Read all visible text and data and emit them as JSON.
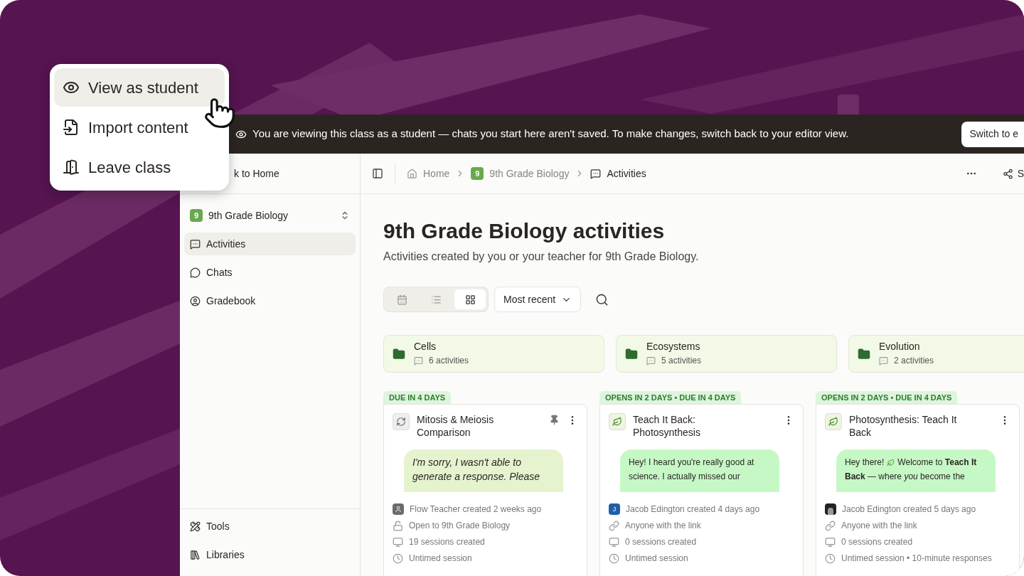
{
  "menu": {
    "items": [
      {
        "label": "View as student",
        "kind": "view",
        "selected": true
      },
      {
        "label": "Import content",
        "kind": "import",
        "selected": false
      },
      {
        "label": "Leave class",
        "kind": "leave",
        "selected": false
      }
    ]
  },
  "banner": {
    "text": "You are viewing this class as a student — chats you start here aren't saved. To make changes, switch back to your editor view.",
    "button": "Switch to e"
  },
  "sidebar": {
    "back_link": "k to Home",
    "class_badge": "9",
    "class_name": "9th Grade Biology",
    "items": [
      {
        "label": "Activities",
        "kind": "activities",
        "selected": true
      },
      {
        "label": "Chats",
        "kind": "chats",
        "selected": false
      },
      {
        "label": "Gradebook",
        "kind": "gradebook",
        "selected": false
      }
    ],
    "footer_items": [
      {
        "label": "Tools",
        "kind": "tools"
      },
      {
        "label": "Libraries",
        "kind": "libraries"
      }
    ]
  },
  "breadcrumbs": [
    {
      "kind": "home",
      "label": "Home"
    },
    {
      "kind": "class",
      "badge": "9",
      "label": "9th Grade Biology"
    },
    {
      "kind": "page",
      "label": "Activities"
    }
  ],
  "share_label": "S",
  "page": {
    "title": "9th Grade Biology activities",
    "subtitle": "Activities created by you or your teacher for 9th Grade Biology."
  },
  "views": [
    {
      "kind": "calendar",
      "selected": false
    },
    {
      "kind": "list",
      "selected": false
    },
    {
      "kind": "grid",
      "selected": true
    }
  ],
  "sort": "Most recent",
  "folders": [
    {
      "name": "Cells",
      "count": "6 activities"
    },
    {
      "name": "Ecosystems",
      "count": "5 activities"
    },
    {
      "name": "Evolution",
      "count": "2 activities"
    }
  ],
  "activities": [
    {
      "tag": "DUE IN 4 DAYS",
      "title": "Mitosis & Meiosis Comparison",
      "kind": "comparison",
      "pinned": true,
      "bubble": {
        "kind": "error",
        "parts": [
          {
            "kind": "text",
            "text": "I'm sorry, I wasn't able to generate a response. Please"
          }
        ]
      },
      "meta": [
        {
          "kind": "author",
          "avatar": {
            "kind": "person"
          },
          "text": "Flow Teacher created 2 weeks ago"
        },
        {
          "kind": "lock",
          "text": "Open to 9th Grade Biology"
        },
        {
          "kind": "sessions",
          "text": "19 sessions created"
        },
        {
          "kind": "timing",
          "text": "Untimed session"
        }
      ]
    },
    {
      "tag": "OPENS IN 2 DAYS • DUE IN 4 DAYS",
      "title": "Teach It Back: Photosynthesis",
      "kind": "teach",
      "pinned": false,
      "bubble": {
        "kind": "message",
        "parts": [
          {
            "kind": "text",
            "text": "Hey! I heard you're really good at science. I actually missed our"
          }
        ]
      },
      "meta": [
        {
          "kind": "author",
          "avatar": {
            "kind": "letter",
            "initial": "J"
          },
          "text": "Jacob Edington created 4 days ago"
        },
        {
          "kind": "link",
          "text": "Anyone with the link"
        },
        {
          "kind": "sessions",
          "text": "0 sessions created"
        },
        {
          "kind": "timing",
          "text": "Untimed session"
        }
      ]
    },
    {
      "tag": "OPENS IN 2 DAYS • DUE IN 4 DAYS",
      "title": "Photosynthesis: Teach It Back",
      "kind": "teach",
      "pinned": false,
      "bubble": {
        "kind": "message",
        "parts": [
          {
            "kind": "text",
            "text": "Hey there!"
          },
          {
            "kind": "leaf"
          },
          {
            "kind": "text",
            "text": "Welcome to **Teach It**"
          },
          {
            "kind": "text",
            "text": "**Back** — where *you* become the"
          }
        ]
      },
      "meta": [
        {
          "kind": "author",
          "avatar": {
            "kind": "photo"
          },
          "text": "Jacob Edington created 5 days ago"
        },
        {
          "kind": "link",
          "text": "Anyone with the link"
        },
        {
          "kind": "sessions",
          "text": "0 sessions created"
        },
        {
          "kind": "timing",
          "text": "Untimed session • 10-minute responses"
        }
      ]
    }
  ]
}
